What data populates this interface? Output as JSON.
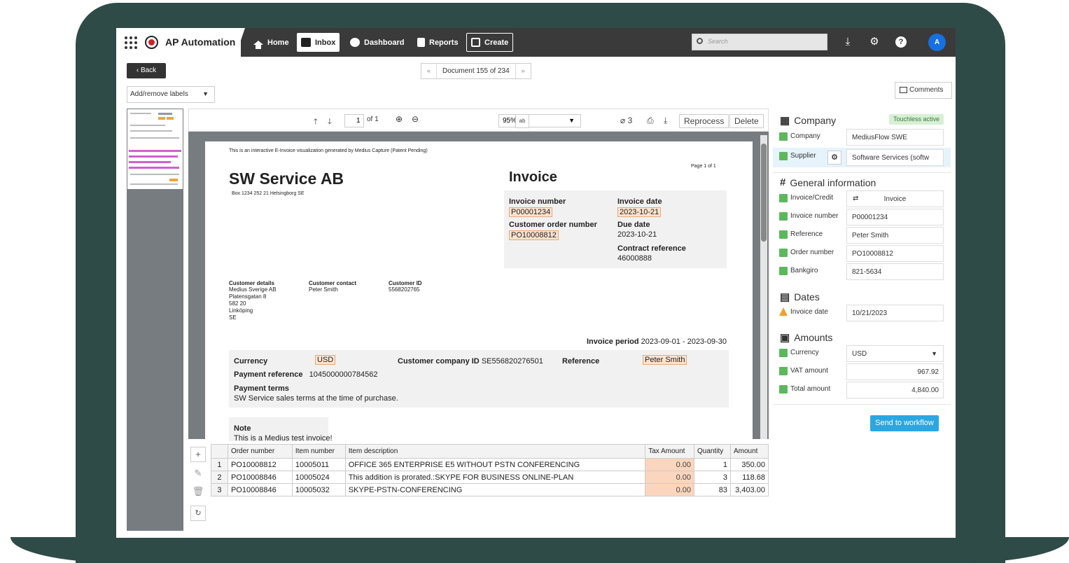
{
  "app": {
    "title": "AP Automation",
    "nav": [
      {
        "label": "Home"
      },
      {
        "label": "Inbox"
      },
      {
        "label": "Dashboard"
      },
      {
        "label": "Reports"
      },
      {
        "label": "Create"
      }
    ],
    "search_placeholder": "Search",
    "avatar": "A"
  },
  "toolbar": {
    "back": "Back",
    "pager_prev": "«",
    "pager_label": "Document 155 of 234",
    "pager_next": "»",
    "labels": "Add/remove labels",
    "comments": "Comments"
  },
  "viewer": {
    "page_input": "1",
    "page_of": "of 1",
    "zoom": "95%",
    "attachments": "3",
    "reprocess": "Reprocess",
    "delete": "Delete"
  },
  "invoice": {
    "notice": "This is an interactive E-Invoice visualization generated by Medius Capture (Patent Pending)",
    "page": "Page 1 of 1",
    "supplier": "SW Service AB",
    "supplier_address": "Box 1234 252 21 Helsingborg SE",
    "doc_title": "Invoice",
    "invoice_number_label": "Invoice number",
    "invoice_number": "P00001234",
    "invoice_date_label": "Invoice date",
    "invoice_date": "2023-10-21",
    "order_number_label": "Customer order number",
    "order_number": "PO10008812",
    "due_date_label": "Due date",
    "due_date": "2023-10-21",
    "contract_label": "Contract reference",
    "contract": "46000888",
    "customer_details_label": "Customer details",
    "customer_details": [
      "Medius Sverige AB",
      "Platensgatan 8",
      "582 20",
      "Linköping",
      "SE"
    ],
    "customer_contact_label": "Customer contact",
    "customer_contact": "Peter Smith",
    "customer_id_label": "Customer ID",
    "customer_id": "5568202765",
    "period_label": "Invoice period",
    "period": "2023-09-01 - 2023-09-30",
    "currency_label": "Currency",
    "currency": "USD",
    "company_id_label": "Customer company ID",
    "company_id": "SE556820276501",
    "reference_label": "Reference",
    "reference": "Peter Smith",
    "payref_label": "Payment reference",
    "payref": "1045000000784562",
    "terms_label": "Payment terms",
    "terms": "SW Service sales terms at the time of purchase.",
    "note_label": "Note",
    "note": "This is a Medius test invoice!"
  },
  "items": {
    "headers": [
      "Order number",
      "Item number",
      "Item description",
      "Tax Amount",
      "Quantity",
      "Amount"
    ],
    "rows": [
      {
        "n": "1",
        "order": "PO10008812",
        "item": "10005011",
        "desc": "OFFICE 365 ENTERPRISE E5 WITHOUT PSTN CONFERENCING",
        "tax": "0.00",
        "qty": "1",
        "amount": "350.00"
      },
      {
        "n": "2",
        "order": "PO10008846",
        "item": "10005024",
        "desc": "This addition is prorated.:SKYPE FOR BUSINESS ONLINE-PLAN",
        "tax": "0.00",
        "qty": "3",
        "amount": "118.68"
      },
      {
        "n": "3",
        "order": "PO10008846",
        "item": "10005032",
        "desc": "SKYPE-PSTN-CONFERENCING",
        "tax": "0.00",
        "qty": "83",
        "amount": "3,403.00"
      }
    ]
  },
  "panel": {
    "company_title": "Company",
    "touchless": "Touchless active",
    "company_label": "Company",
    "company_value": "MediusFlow SWE",
    "supplier_label": "Supplier",
    "supplier_value": "Software Services (softw",
    "general_title": "General information",
    "invoice_credit_label": "Invoice/Credit",
    "invoice_credit_value": "Invoice",
    "invoice_number_label": "Invoice number",
    "invoice_number_value": "P00001234",
    "reference_label": "Reference",
    "reference_value": "Peter Smith",
    "order_label": "Order number",
    "order_value": "PO10008812",
    "bankgiro_label": "Bankgiro",
    "bankgiro_value": "821-5634",
    "dates_title": "Dates",
    "invoice_date_label": "Invoice date",
    "invoice_date_value": "10/21/2023",
    "amounts_title": "Amounts",
    "currency_label": "Currency",
    "currency_value": "USD",
    "vat_label": "VAT amount",
    "vat_value": "967.92",
    "total_label": "Total amount",
    "total_value": "4,840.00",
    "send": "Send to workflow"
  }
}
